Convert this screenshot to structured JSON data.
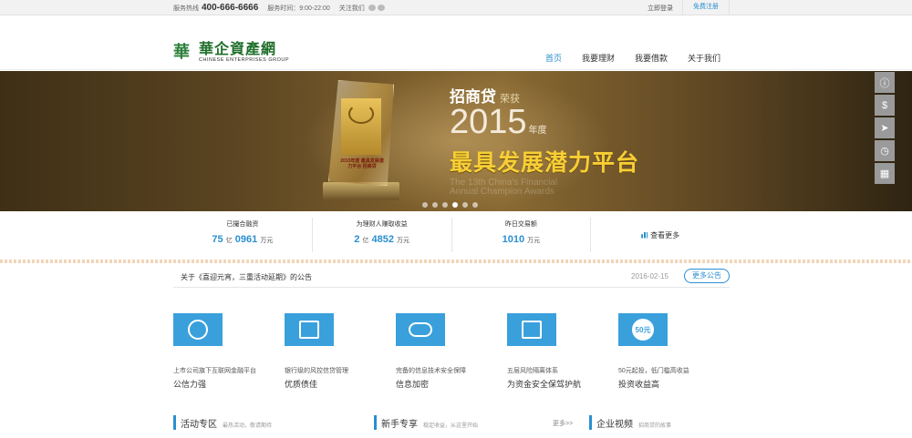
{
  "topbar": {
    "hotline_label": "服务热线",
    "hotline": "400-666-6666",
    "hours": "服务时间：9:00-22:00",
    "follow": "关注我们",
    "login": "立即登录",
    "register": "免费注册"
  },
  "logo": {
    "mark": "華",
    "name": "華企資產網",
    "en": "CHINESE ENTERPRISES GROUP"
  },
  "nav": [
    "首页",
    "我要理财",
    "我要借款",
    "关于我们"
  ],
  "banner": {
    "title": "招商贷",
    "title_suffix": "荣获",
    "year": "2015",
    "year_suffix": "年度",
    "headline": "最具发展潜力平台",
    "en": "The 13th China's Financial Annual Champion Awards",
    "trophy_text": "2015年度 最具发展潜力平台 招商贷",
    "slide_count": 6,
    "active_slide": 4
  },
  "sidebar_icons": [
    "info-icon",
    "dollar-icon",
    "send-icon",
    "clock-icon",
    "calculator-icon"
  ],
  "stats": [
    {
      "label": "已撮合融资",
      "num1": "75",
      "unit1": "亿",
      "num2": "0961",
      "unit2": "万元"
    },
    {
      "label": "为理财人赚取收益",
      "num1": "2",
      "unit1": "亿",
      "num2": "4852",
      "unit2": "万元"
    },
    {
      "label": "昨日交易额",
      "num1": "1010",
      "unit1": "",
      "num2": "",
      "unit2": "万元"
    }
  ],
  "stats_more": "查看更多",
  "notice": {
    "text": "关于《喜迎元宵，三重活动延期》的公告",
    "date": "2016-02-15",
    "more": "更多公告"
  },
  "features": [
    {
      "sub": "上市公司旗下互联网金融平台",
      "main": "公信力强"
    },
    {
      "sub": "银行级的风控信贷管理",
      "main": "优质债佳"
    },
    {
      "sub": "完备的信息技术安全保障",
      "main": "信息加密"
    },
    {
      "sub": "五层风险隔离体系",
      "main": "为资金安全保驾护航"
    },
    {
      "sub": "50元起投，低门槛高收益",
      "main": "投资收益高"
    }
  ],
  "feature_badge": "50元",
  "sections": [
    {
      "title": "活动专区",
      "sub": "最热活动，敬请期待"
    },
    {
      "title": "新手专享",
      "sub": "稳定收益，从这里开始"
    },
    {
      "title": "企业视频",
      "sub": "招商贷的故事"
    }
  ],
  "section_more": "更多>>",
  "colors": {
    "accent": "#2a8fd0",
    "logo_green": "#1f6f2b",
    "headline_gold": "#f7cf35"
  }
}
